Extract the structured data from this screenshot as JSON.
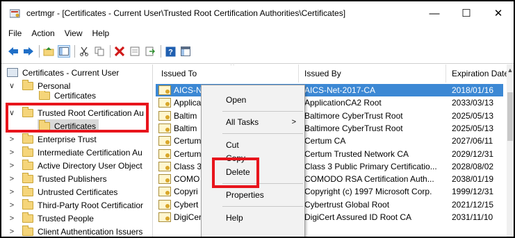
{
  "window": {
    "title": "certmgr - [Certificates - Current User\\Trusted Root Certification Authorities\\Certificates]",
    "minimize": "—",
    "maximize": "☐",
    "close": "✕"
  },
  "menu": [
    "File",
    "Action",
    "View",
    "Help"
  ],
  "toolbar": {
    "icons": [
      "back-icon",
      "forward-icon",
      "up-folder-icon",
      "show-hide-tree-icon",
      "cut-icon",
      "copy-icon",
      "delete-icon",
      "properties-icon",
      "export-icon",
      "help-icon",
      "console-icon"
    ]
  },
  "tree": {
    "root": "Certificates - Current User",
    "items": [
      {
        "label": "Personal",
        "expander": "∨"
      },
      {
        "label": "Certificates",
        "expander": ""
      },
      {
        "label": "Trusted Root Certification Au",
        "expander": "∨"
      },
      {
        "label": "Certificates",
        "expander": ""
      },
      {
        "label": "Enterprise Trust",
        "expander": ">"
      },
      {
        "label": "Intermediate Certification Au",
        "expander": ">"
      },
      {
        "label": "Active Directory User Object",
        "expander": ">"
      },
      {
        "label": "Trusted Publishers",
        "expander": ">"
      },
      {
        "label": "Untrusted Certificates",
        "expander": ">"
      },
      {
        "label": "Third-Party Root Certificatior",
        "expander": ">"
      },
      {
        "label": "Trusted People",
        "expander": ">"
      },
      {
        "label": "Client Authentication Issuers",
        "expander": ">"
      }
    ]
  },
  "list": {
    "columns": [
      "Issued To",
      "Issued By",
      "Expiration Date"
    ],
    "sort_indicator": "^",
    "rows": [
      {
        "issued_to": "AICS-Net-2017-CA",
        "issued_by": "AICS-Net-2017-CA",
        "expires": "2018/01/16"
      },
      {
        "issued_to": "Applica",
        "issued_by": "ApplicationCA2 Root",
        "expires": "2033/03/13"
      },
      {
        "issued_to": "Baltim",
        "issued_by": "Baltimore CyberTrust Root",
        "expires": "2025/05/13"
      },
      {
        "issued_to": "Baltim",
        "issued_by": "Baltimore CyberTrust Root",
        "expires": "2025/05/13"
      },
      {
        "issued_to": "Certum",
        "issued_by": "Certum CA",
        "expires": "2027/06/11"
      },
      {
        "issued_to": "Certum",
        "issued_by": "Certum Trusted Network CA",
        "expires": "2029/12/31"
      },
      {
        "issued_to": "Class 3",
        "issued_by": "Class 3 Public Primary Certificatio...",
        "expires": "2028/08/02"
      },
      {
        "issued_to": "COMO",
        "issued_by": "COMODO RSA Certification Auth...",
        "expires": "2038/01/19"
      },
      {
        "issued_to": "Copyri",
        "issued_by": "Copyright (c) 1997 Microsoft Corp.",
        "expires": "1999/12/31"
      },
      {
        "issued_to": "Cybert",
        "issued_by": "Cybertrust Global Root",
        "expires": "2021/12/15"
      },
      {
        "issued_to": "DigiCert Assured ID Root CA",
        "issued_by": "DigiCert Assured ID Root CA",
        "expires": "2031/11/10"
      }
    ]
  },
  "context_menu": {
    "open": "Open",
    "all_tasks": "All Tasks",
    "submenu_arrow": ">",
    "cut": "Cut",
    "copy": "Copy",
    "delete": "Delete",
    "properties": "Properties",
    "help": "Help"
  },
  "colors": {
    "selection": "#3c88d4",
    "highlight": "#e8141c"
  }
}
